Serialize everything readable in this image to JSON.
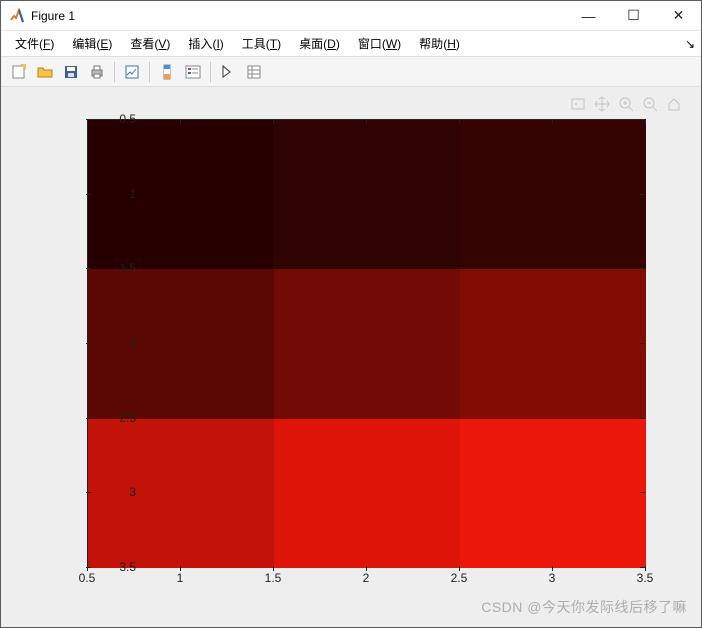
{
  "window": {
    "title": "Figure 1",
    "min_label": "—",
    "max_label": "☐",
    "close_label": "✕"
  },
  "menu": {
    "items": [
      {
        "label": "文件",
        "mn": "F"
      },
      {
        "label": "编辑",
        "mn": "E"
      },
      {
        "label": "查看",
        "mn": "V"
      },
      {
        "label": "插入",
        "mn": "I"
      },
      {
        "label": "工具",
        "mn": "T"
      },
      {
        "label": "桌面",
        "mn": "D"
      },
      {
        "label": "窗口",
        "mn": "W"
      },
      {
        "label": "帮助",
        "mn": "H"
      }
    ]
  },
  "chart_data": {
    "type": "heatmap",
    "x": [
      1,
      2,
      3
    ],
    "y": [
      1,
      2,
      3
    ],
    "z": [
      [
        1,
        2,
        3
      ],
      [
        4,
        5,
        6
      ],
      [
        7,
        8,
        9
      ]
    ],
    "colors": [
      [
        "#260000",
        "#2e0302",
        "#340403"
      ],
      [
        "#5b0703",
        "#720b05",
        "#830d05"
      ],
      [
        "#c31207",
        "#df1409",
        "#ec170b"
      ]
    ],
    "xticks": [
      "0.5",
      "1",
      "1.5",
      "2",
      "2.5",
      "3",
      "3.5"
    ],
    "yticks": [
      "0.5",
      "1",
      "1.5",
      "2",
      "2.5",
      "3",
      "3.5"
    ],
    "xlim": [
      0.5,
      3.5
    ],
    "ylim": [
      0.5,
      3.5
    ],
    "ydir": "reverse",
    "colormap": "hot-dark-red"
  },
  "watermark": "CSDN @今天你发际线后移了嘛"
}
